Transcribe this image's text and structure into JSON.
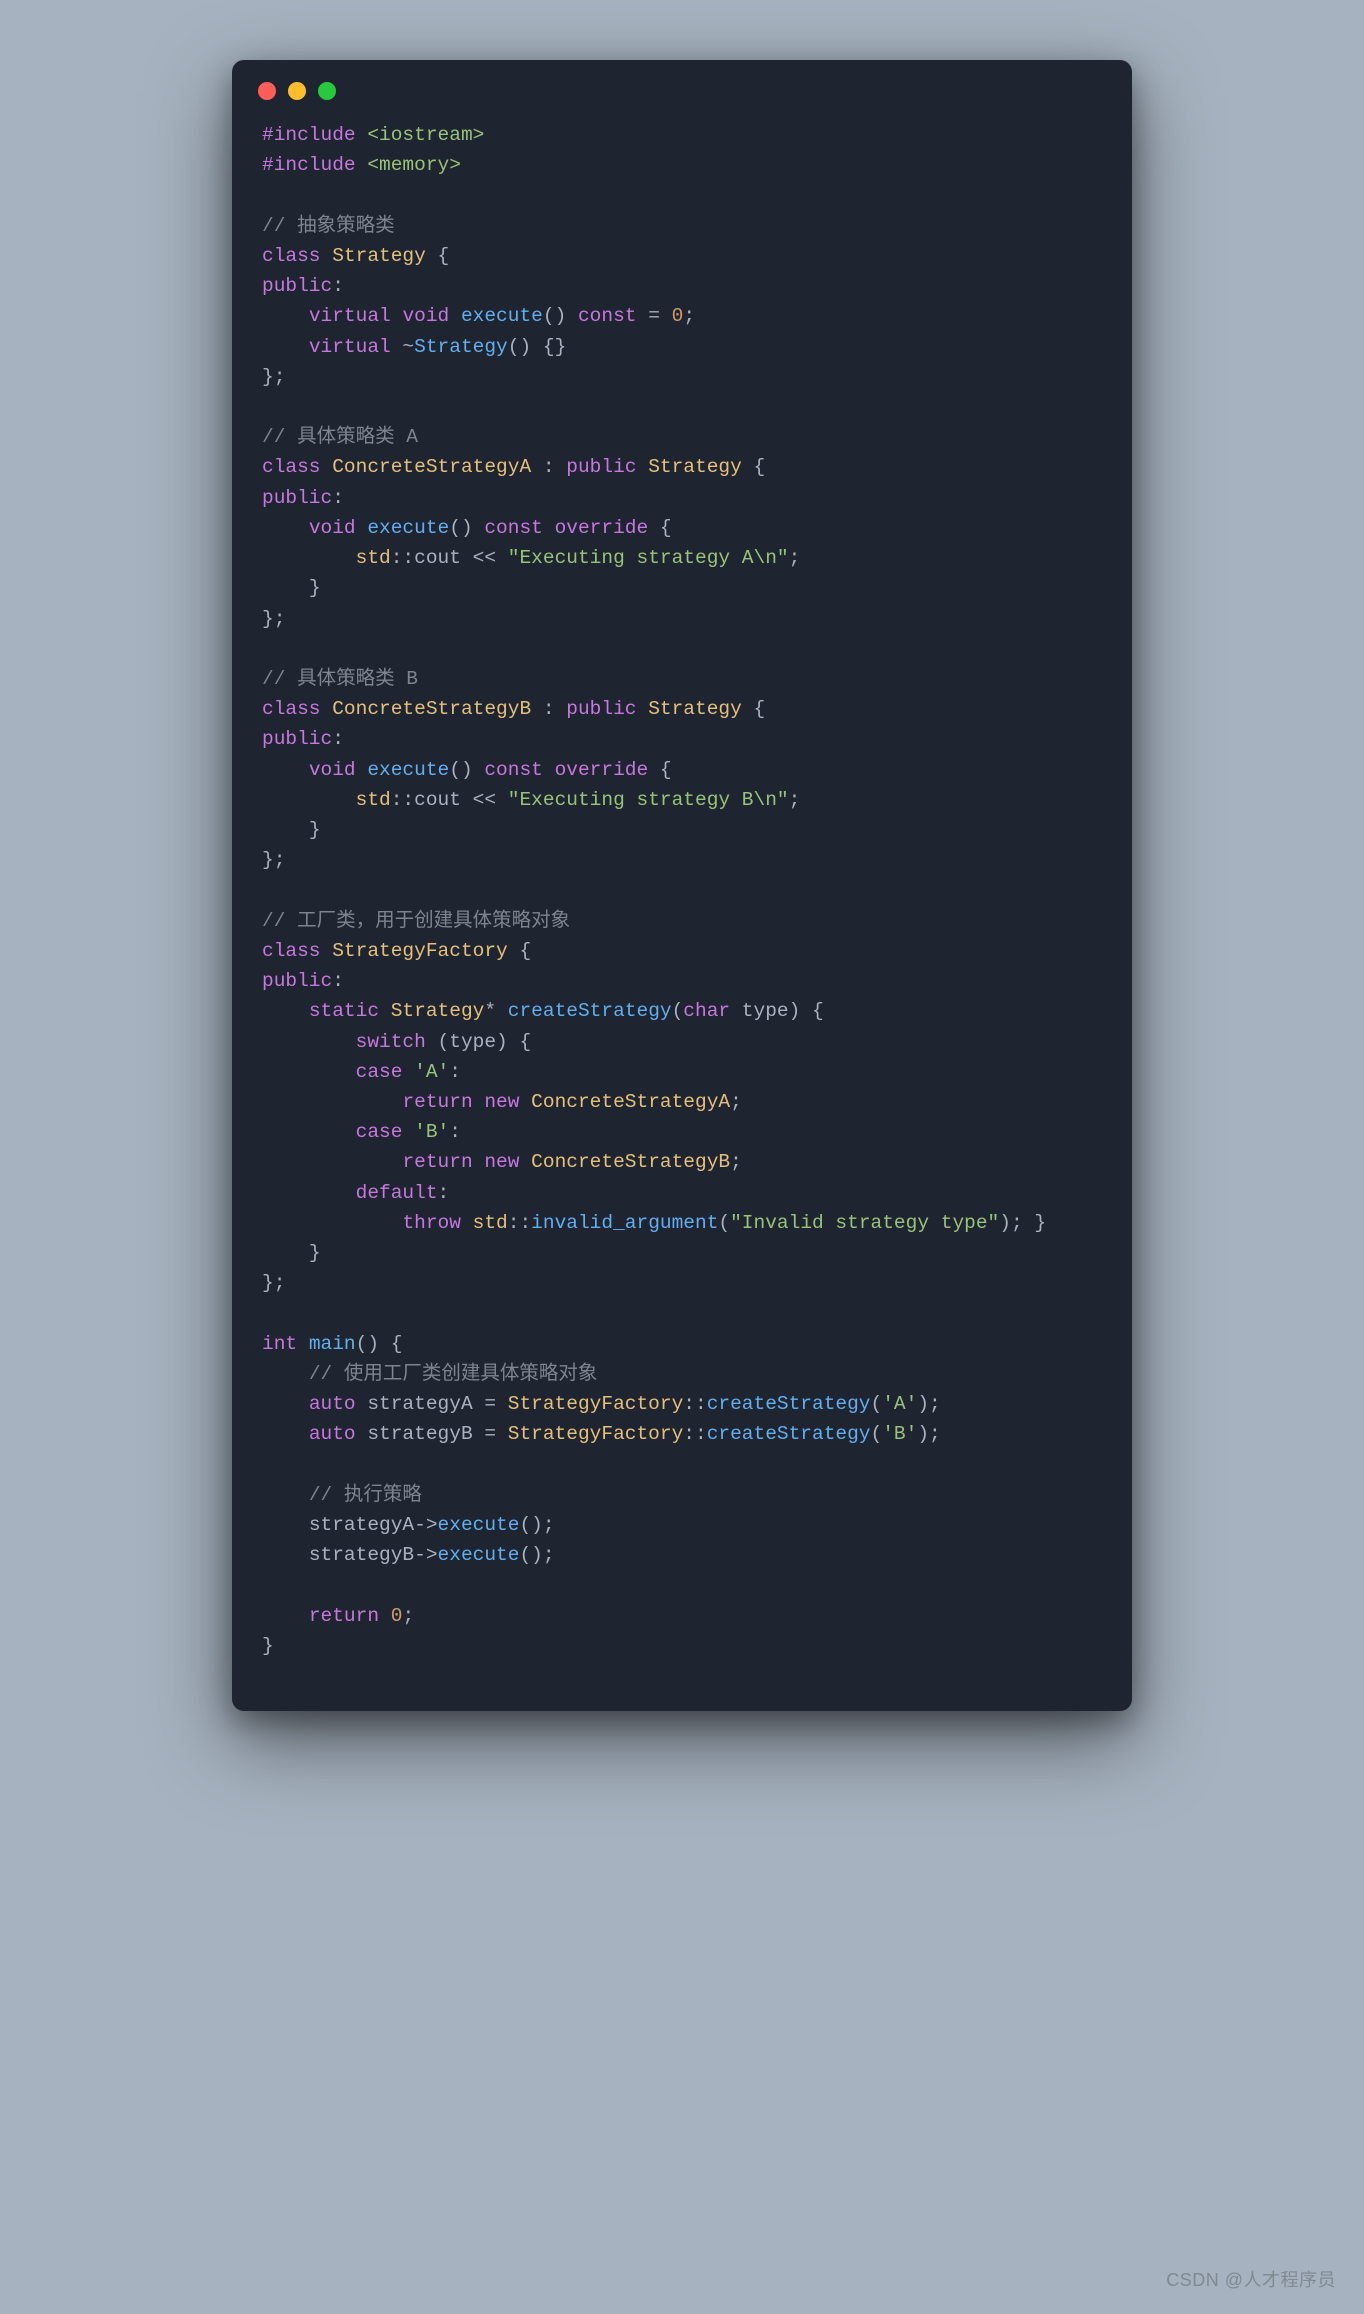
{
  "watermark": "CSDN @人才程序员",
  "window": {
    "dots": [
      "red",
      "yellow",
      "green"
    ]
  },
  "code": {
    "lines": [
      [
        [
          "pp",
          "#include"
        ],
        [
          "punc",
          " "
        ],
        [
          "inc",
          "<iostream>"
        ]
      ],
      [
        [
          "pp",
          "#include"
        ],
        [
          "punc",
          " "
        ],
        [
          "inc",
          "<memory>"
        ]
      ],
      [
        [
          "punc",
          ""
        ]
      ],
      [
        [
          "cmt",
          "// 抽象策略类"
        ]
      ],
      [
        [
          "kw",
          "class"
        ],
        [
          "punc",
          " "
        ],
        [
          "type",
          "Strategy"
        ],
        [
          "punc",
          " {"
        ]
      ],
      [
        [
          "kw",
          "public"
        ],
        [
          "punc",
          ":"
        ]
      ],
      [
        [
          "punc",
          "    "
        ],
        [
          "kw",
          "virtual"
        ],
        [
          "punc",
          " "
        ],
        [
          "kw",
          "void"
        ],
        [
          "punc",
          " "
        ],
        [
          "func",
          "execute"
        ],
        [
          "punc",
          "() "
        ],
        [
          "kw",
          "const"
        ],
        [
          "punc",
          " = "
        ],
        [
          "num",
          "0"
        ],
        [
          "punc",
          ";"
        ]
      ],
      [
        [
          "punc",
          "    "
        ],
        [
          "kw",
          "virtual"
        ],
        [
          "punc",
          " ~"
        ],
        [
          "func",
          "Strategy"
        ],
        [
          "punc",
          "() {}"
        ]
      ],
      [
        [
          "punc",
          "};"
        ]
      ],
      [
        [
          "punc",
          ""
        ]
      ],
      [
        [
          "cmt",
          "// 具体策略类 A"
        ]
      ],
      [
        [
          "kw",
          "class"
        ],
        [
          "punc",
          " "
        ],
        [
          "type",
          "ConcreteStrategyA"
        ],
        [
          "punc",
          " : "
        ],
        [
          "kw",
          "public"
        ],
        [
          "punc",
          " "
        ],
        [
          "type",
          "Strategy"
        ],
        [
          "punc",
          " {"
        ]
      ],
      [
        [
          "kw",
          "public"
        ],
        [
          "punc",
          ":"
        ]
      ],
      [
        [
          "punc",
          "    "
        ],
        [
          "kw",
          "void"
        ],
        [
          "punc",
          " "
        ],
        [
          "func",
          "execute"
        ],
        [
          "punc",
          "() "
        ],
        [
          "kw",
          "const"
        ],
        [
          "punc",
          " "
        ],
        [
          "kw",
          "override"
        ],
        [
          "punc",
          " {"
        ]
      ],
      [
        [
          "punc",
          "        "
        ],
        [
          "ns",
          "std"
        ],
        [
          "punc",
          "::cout << "
        ],
        [
          "str",
          "\"Executing strategy A\\n\""
        ],
        [
          "punc",
          ";"
        ]
      ],
      [
        [
          "punc",
          "    }"
        ]
      ],
      [
        [
          "punc",
          "};"
        ]
      ],
      [
        [
          "punc",
          ""
        ]
      ],
      [
        [
          "cmt",
          "// 具体策略类 B"
        ]
      ],
      [
        [
          "kw",
          "class"
        ],
        [
          "punc",
          " "
        ],
        [
          "type",
          "ConcreteStrategyB"
        ],
        [
          "punc",
          " : "
        ],
        [
          "kw",
          "public"
        ],
        [
          "punc",
          " "
        ],
        [
          "type",
          "Strategy"
        ],
        [
          "punc",
          " {"
        ]
      ],
      [
        [
          "kw",
          "public"
        ],
        [
          "punc",
          ":"
        ]
      ],
      [
        [
          "punc",
          "    "
        ],
        [
          "kw",
          "void"
        ],
        [
          "punc",
          " "
        ],
        [
          "func",
          "execute"
        ],
        [
          "punc",
          "() "
        ],
        [
          "kw",
          "const"
        ],
        [
          "punc",
          " "
        ],
        [
          "kw",
          "override"
        ],
        [
          "punc",
          " {"
        ]
      ],
      [
        [
          "punc",
          "        "
        ],
        [
          "ns",
          "std"
        ],
        [
          "punc",
          "::cout << "
        ],
        [
          "str",
          "\"Executing strategy B\\n\""
        ],
        [
          "punc",
          ";"
        ]
      ],
      [
        [
          "punc",
          "    }"
        ]
      ],
      [
        [
          "punc",
          "};"
        ]
      ],
      [
        [
          "punc",
          ""
        ]
      ],
      [
        [
          "cmt",
          "// 工厂类，用于创建具体策略对象"
        ]
      ],
      [
        [
          "kw",
          "class"
        ],
        [
          "punc",
          " "
        ],
        [
          "type",
          "StrategyFactory"
        ],
        [
          "punc",
          " {"
        ]
      ],
      [
        [
          "kw",
          "public"
        ],
        [
          "punc",
          ":"
        ]
      ],
      [
        [
          "punc",
          "    "
        ],
        [
          "kw",
          "static"
        ],
        [
          "punc",
          " "
        ],
        [
          "type",
          "Strategy"
        ],
        [
          "punc",
          "* "
        ],
        [
          "func",
          "createStrategy"
        ],
        [
          "punc",
          "("
        ],
        [
          "kw",
          "char"
        ],
        [
          "punc",
          " type) {"
        ]
      ],
      [
        [
          "punc",
          "        "
        ],
        [
          "kw",
          "switch"
        ],
        [
          "punc",
          " (type) {"
        ]
      ],
      [
        [
          "punc",
          "        "
        ],
        [
          "kw",
          "case"
        ],
        [
          "punc",
          " "
        ],
        [
          "char",
          "'A'"
        ],
        [
          "punc",
          ":"
        ]
      ],
      [
        [
          "punc",
          "            "
        ],
        [
          "kw",
          "return"
        ],
        [
          "punc",
          " "
        ],
        [
          "kw",
          "new"
        ],
        [
          "punc",
          " "
        ],
        [
          "type",
          "ConcreteStrategyA"
        ],
        [
          "punc",
          ";"
        ]
      ],
      [
        [
          "punc",
          "        "
        ],
        [
          "kw",
          "case"
        ],
        [
          "punc",
          " "
        ],
        [
          "char",
          "'B'"
        ],
        [
          "punc",
          ":"
        ]
      ],
      [
        [
          "punc",
          "            "
        ],
        [
          "kw",
          "return"
        ],
        [
          "punc",
          " "
        ],
        [
          "kw",
          "new"
        ],
        [
          "punc",
          " "
        ],
        [
          "type",
          "ConcreteStrategyB"
        ],
        [
          "punc",
          ";"
        ]
      ],
      [
        [
          "punc",
          "        "
        ],
        [
          "kw",
          "default"
        ],
        [
          "punc",
          ":"
        ]
      ],
      [
        [
          "punc",
          "            "
        ],
        [
          "kw",
          "throw"
        ],
        [
          "punc",
          " "
        ],
        [
          "ns",
          "std"
        ],
        [
          "punc",
          "::"
        ],
        [
          "func",
          "invalid_argument"
        ],
        [
          "punc",
          "("
        ],
        [
          "str",
          "\"Invalid strategy type\""
        ],
        [
          "punc",
          "); }"
        ]
      ],
      [
        [
          "punc",
          "    }"
        ]
      ],
      [
        [
          "punc",
          "};"
        ]
      ],
      [
        [
          "punc",
          ""
        ]
      ],
      [
        [
          "kw",
          "int"
        ],
        [
          "punc",
          " "
        ],
        [
          "func",
          "main"
        ],
        [
          "punc",
          "() {"
        ]
      ],
      [
        [
          "punc",
          "    "
        ],
        [
          "cmt",
          "// 使用工厂类创建具体策略对象"
        ]
      ],
      [
        [
          "punc",
          "    "
        ],
        [
          "kw",
          "auto"
        ],
        [
          "punc",
          " strategyA = "
        ],
        [
          "type",
          "StrategyFactory"
        ],
        [
          "punc",
          "::"
        ],
        [
          "func",
          "createStrategy"
        ],
        [
          "punc",
          "("
        ],
        [
          "char",
          "'A'"
        ],
        [
          "punc",
          ");"
        ]
      ],
      [
        [
          "punc",
          "    "
        ],
        [
          "kw",
          "auto"
        ],
        [
          "punc",
          " strategyB = "
        ],
        [
          "type",
          "StrategyFactory"
        ],
        [
          "punc",
          "::"
        ],
        [
          "func",
          "createStrategy"
        ],
        [
          "punc",
          "("
        ],
        [
          "char",
          "'B'"
        ],
        [
          "punc",
          ");"
        ]
      ],
      [
        [
          "punc",
          ""
        ]
      ],
      [
        [
          "punc",
          "    "
        ],
        [
          "cmt",
          "// 执行策略"
        ]
      ],
      [
        [
          "punc",
          "    strategyA->"
        ],
        [
          "func",
          "execute"
        ],
        [
          "punc",
          "();"
        ]
      ],
      [
        [
          "punc",
          "    strategyB->"
        ],
        [
          "func",
          "execute"
        ],
        [
          "punc",
          "();"
        ]
      ],
      [
        [
          "punc",
          ""
        ]
      ],
      [
        [
          "punc",
          "    "
        ],
        [
          "kw",
          "return"
        ],
        [
          "punc",
          " "
        ],
        [
          "num",
          "0"
        ],
        [
          "punc",
          ";"
        ]
      ],
      [
        [
          "punc",
          "}"
        ]
      ]
    ]
  }
}
